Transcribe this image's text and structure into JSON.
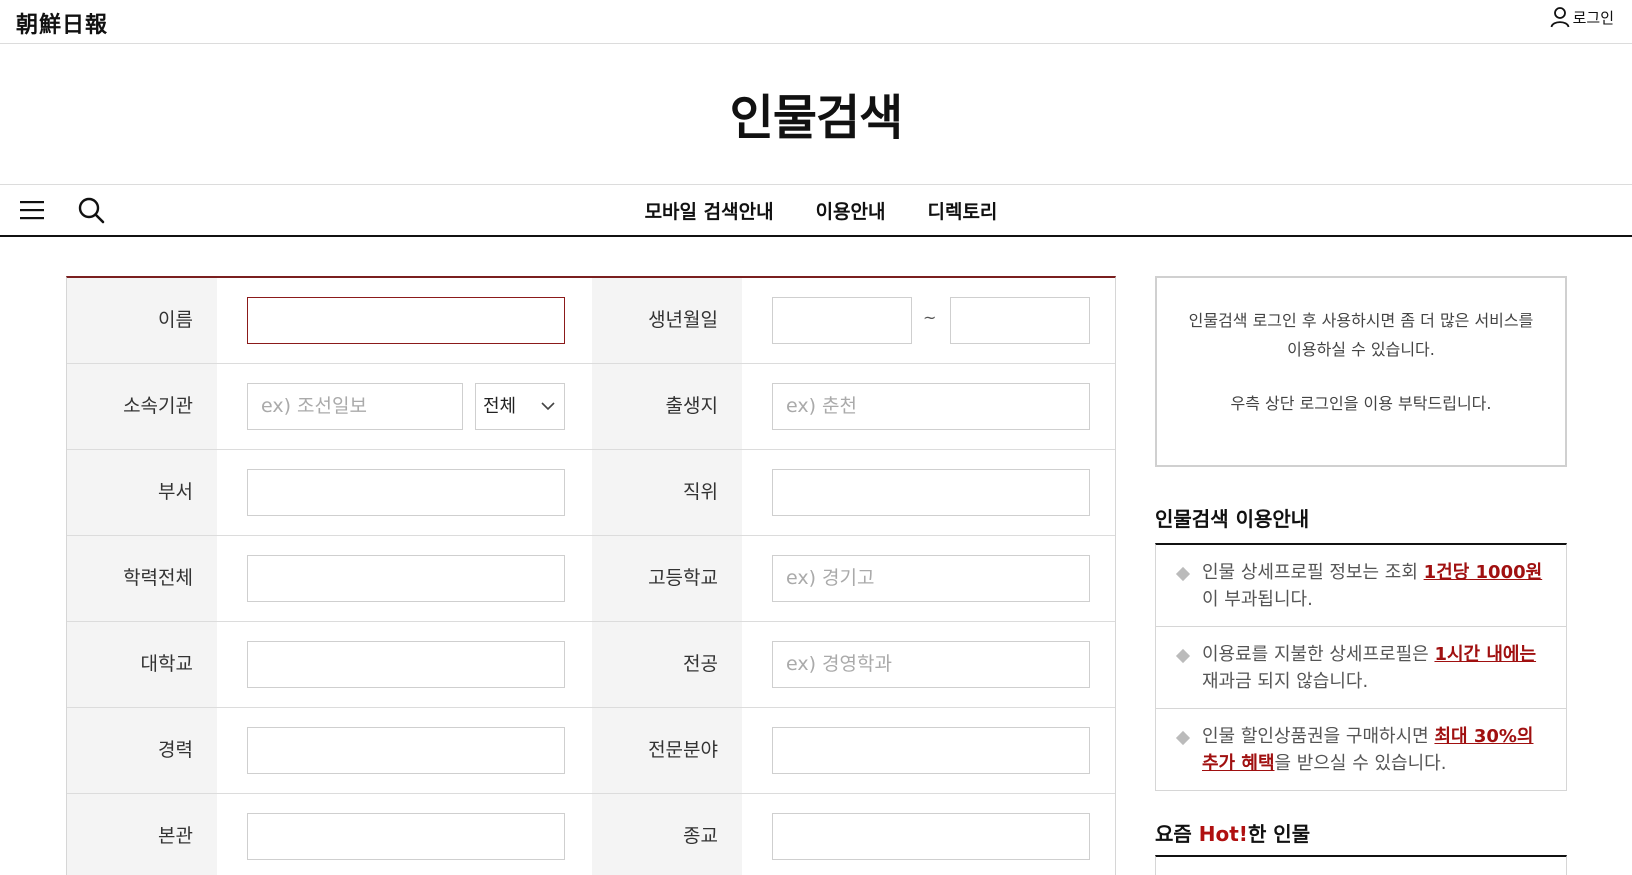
{
  "header": {
    "logo": "朝鮮日報",
    "login": "로그인"
  },
  "page_title": "인물검색",
  "nav": {
    "items": [
      "모바일 검색안내",
      "이용안내",
      "디렉토리"
    ]
  },
  "form": {
    "rows": [
      {
        "left_label": "이름",
        "right_label": "생년월일"
      },
      {
        "left_label": "소속기관",
        "left_placeholder": "ex) 조선일보",
        "select_value": "전체",
        "right_label": "출생지",
        "right_placeholder": "ex) 춘천"
      },
      {
        "left_label": "부서",
        "right_label": "직위"
      },
      {
        "left_label": "학력전체",
        "right_label": "고등학교",
        "right_placeholder": "ex) 경기고"
      },
      {
        "left_label": "대학교",
        "right_label": "전공",
        "right_placeholder": "ex) 경영학과"
      },
      {
        "left_label": "경력",
        "right_label": "전문분야"
      },
      {
        "left_label": "본관",
        "right_label": "종교"
      }
    ],
    "date_separator": "~"
  },
  "sidebar": {
    "login_notice_line1": "인물검색 로그인 후 사용하시면 좀 더 많은 서비스를",
    "login_notice_line2": "이용하실 수 있습니다.",
    "login_notice_line3": "우측 상단 로그인을 이용 부탁드립니다.",
    "guide_title": "인물검색 이용안내",
    "guide": [
      {
        "pre": "인물 상세프로필 정보는 조회 ",
        "hl": "1건당 1000원",
        "post": "이 부과됩니다."
      },
      {
        "pre": "이용료를 지불한 상세프로필은 ",
        "hl": "1시간 내에는",
        "post": " 재과금 되지 않습니다."
      },
      {
        "pre": "인물 할인상품권을 구매하시면 ",
        "hl": "최대 30%의 추가 혜택",
        "post": "을 받으실 수 있습니다."
      }
    ],
    "hot_title_pre": "요즘 ",
    "hot_title_hot": "Hot!",
    "hot_title_post": "한 인물"
  }
}
